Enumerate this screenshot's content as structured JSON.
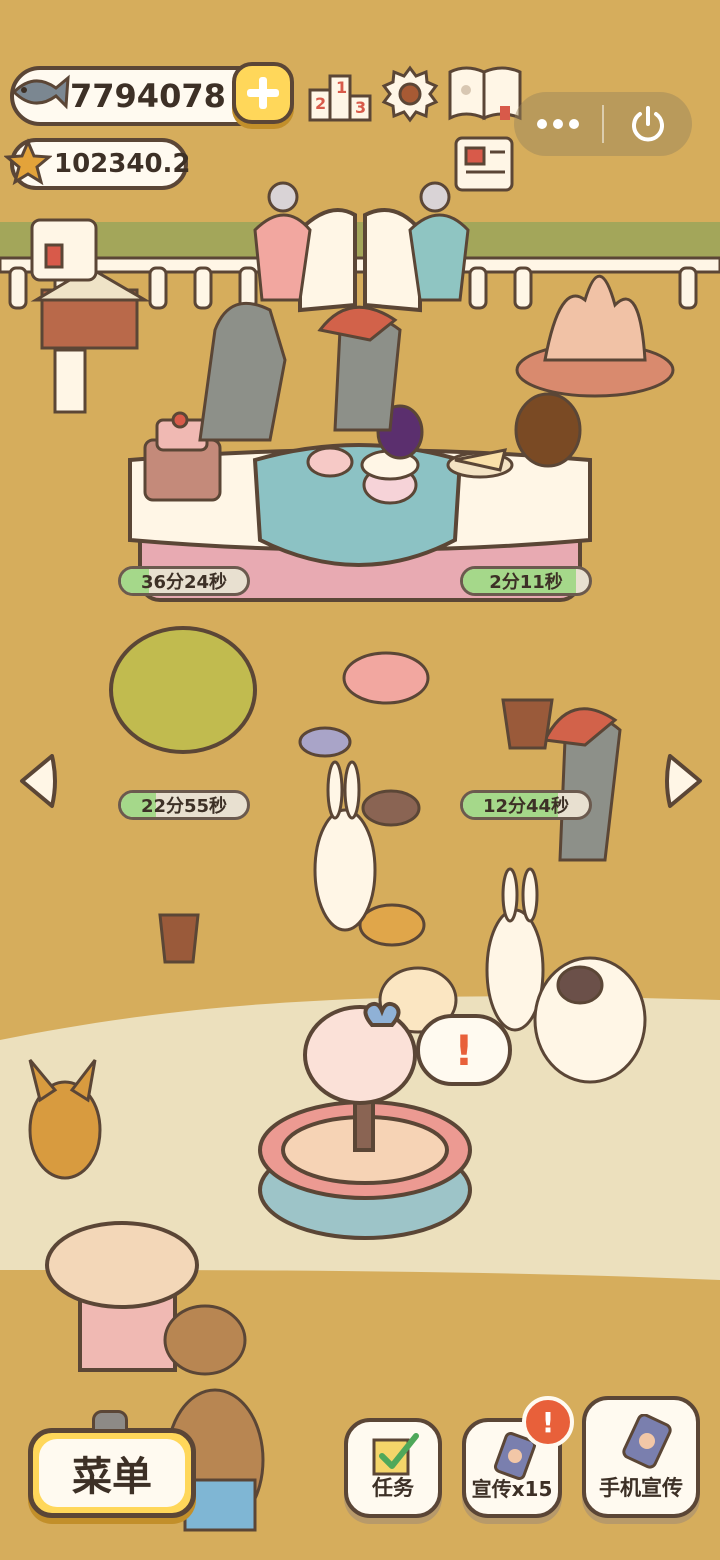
{
  "currency": {
    "fish_count": "7794078",
    "star_count": "102340.2"
  },
  "top_icons": {
    "ranking_digits": [
      "1",
      "2",
      "3"
    ]
  },
  "timers": [
    {
      "label": "36分24秒",
      "progress": 0.22
    },
    {
      "label": "2分11秒",
      "progress": 0.9
    },
    {
      "label": "22分55秒",
      "progress": 0.28
    },
    {
      "label": "12分44秒",
      "progress": 0.75
    }
  ],
  "bottom_bar": {
    "menu_label": "菜单",
    "tasks_label": "任务",
    "promote_label": "宣传x15",
    "phone_promote_label": "手机宣传",
    "alert_mark": "!"
  },
  "speech_bubble": {
    "mark": "!"
  },
  "colors": {
    "ground": "#d6ad5c",
    "path": "#ece0bd",
    "outline": "#5b4636",
    "button_yellow": "#ffd75a",
    "alert_red": "#e8603a",
    "timer_green": "#a5d88a"
  }
}
